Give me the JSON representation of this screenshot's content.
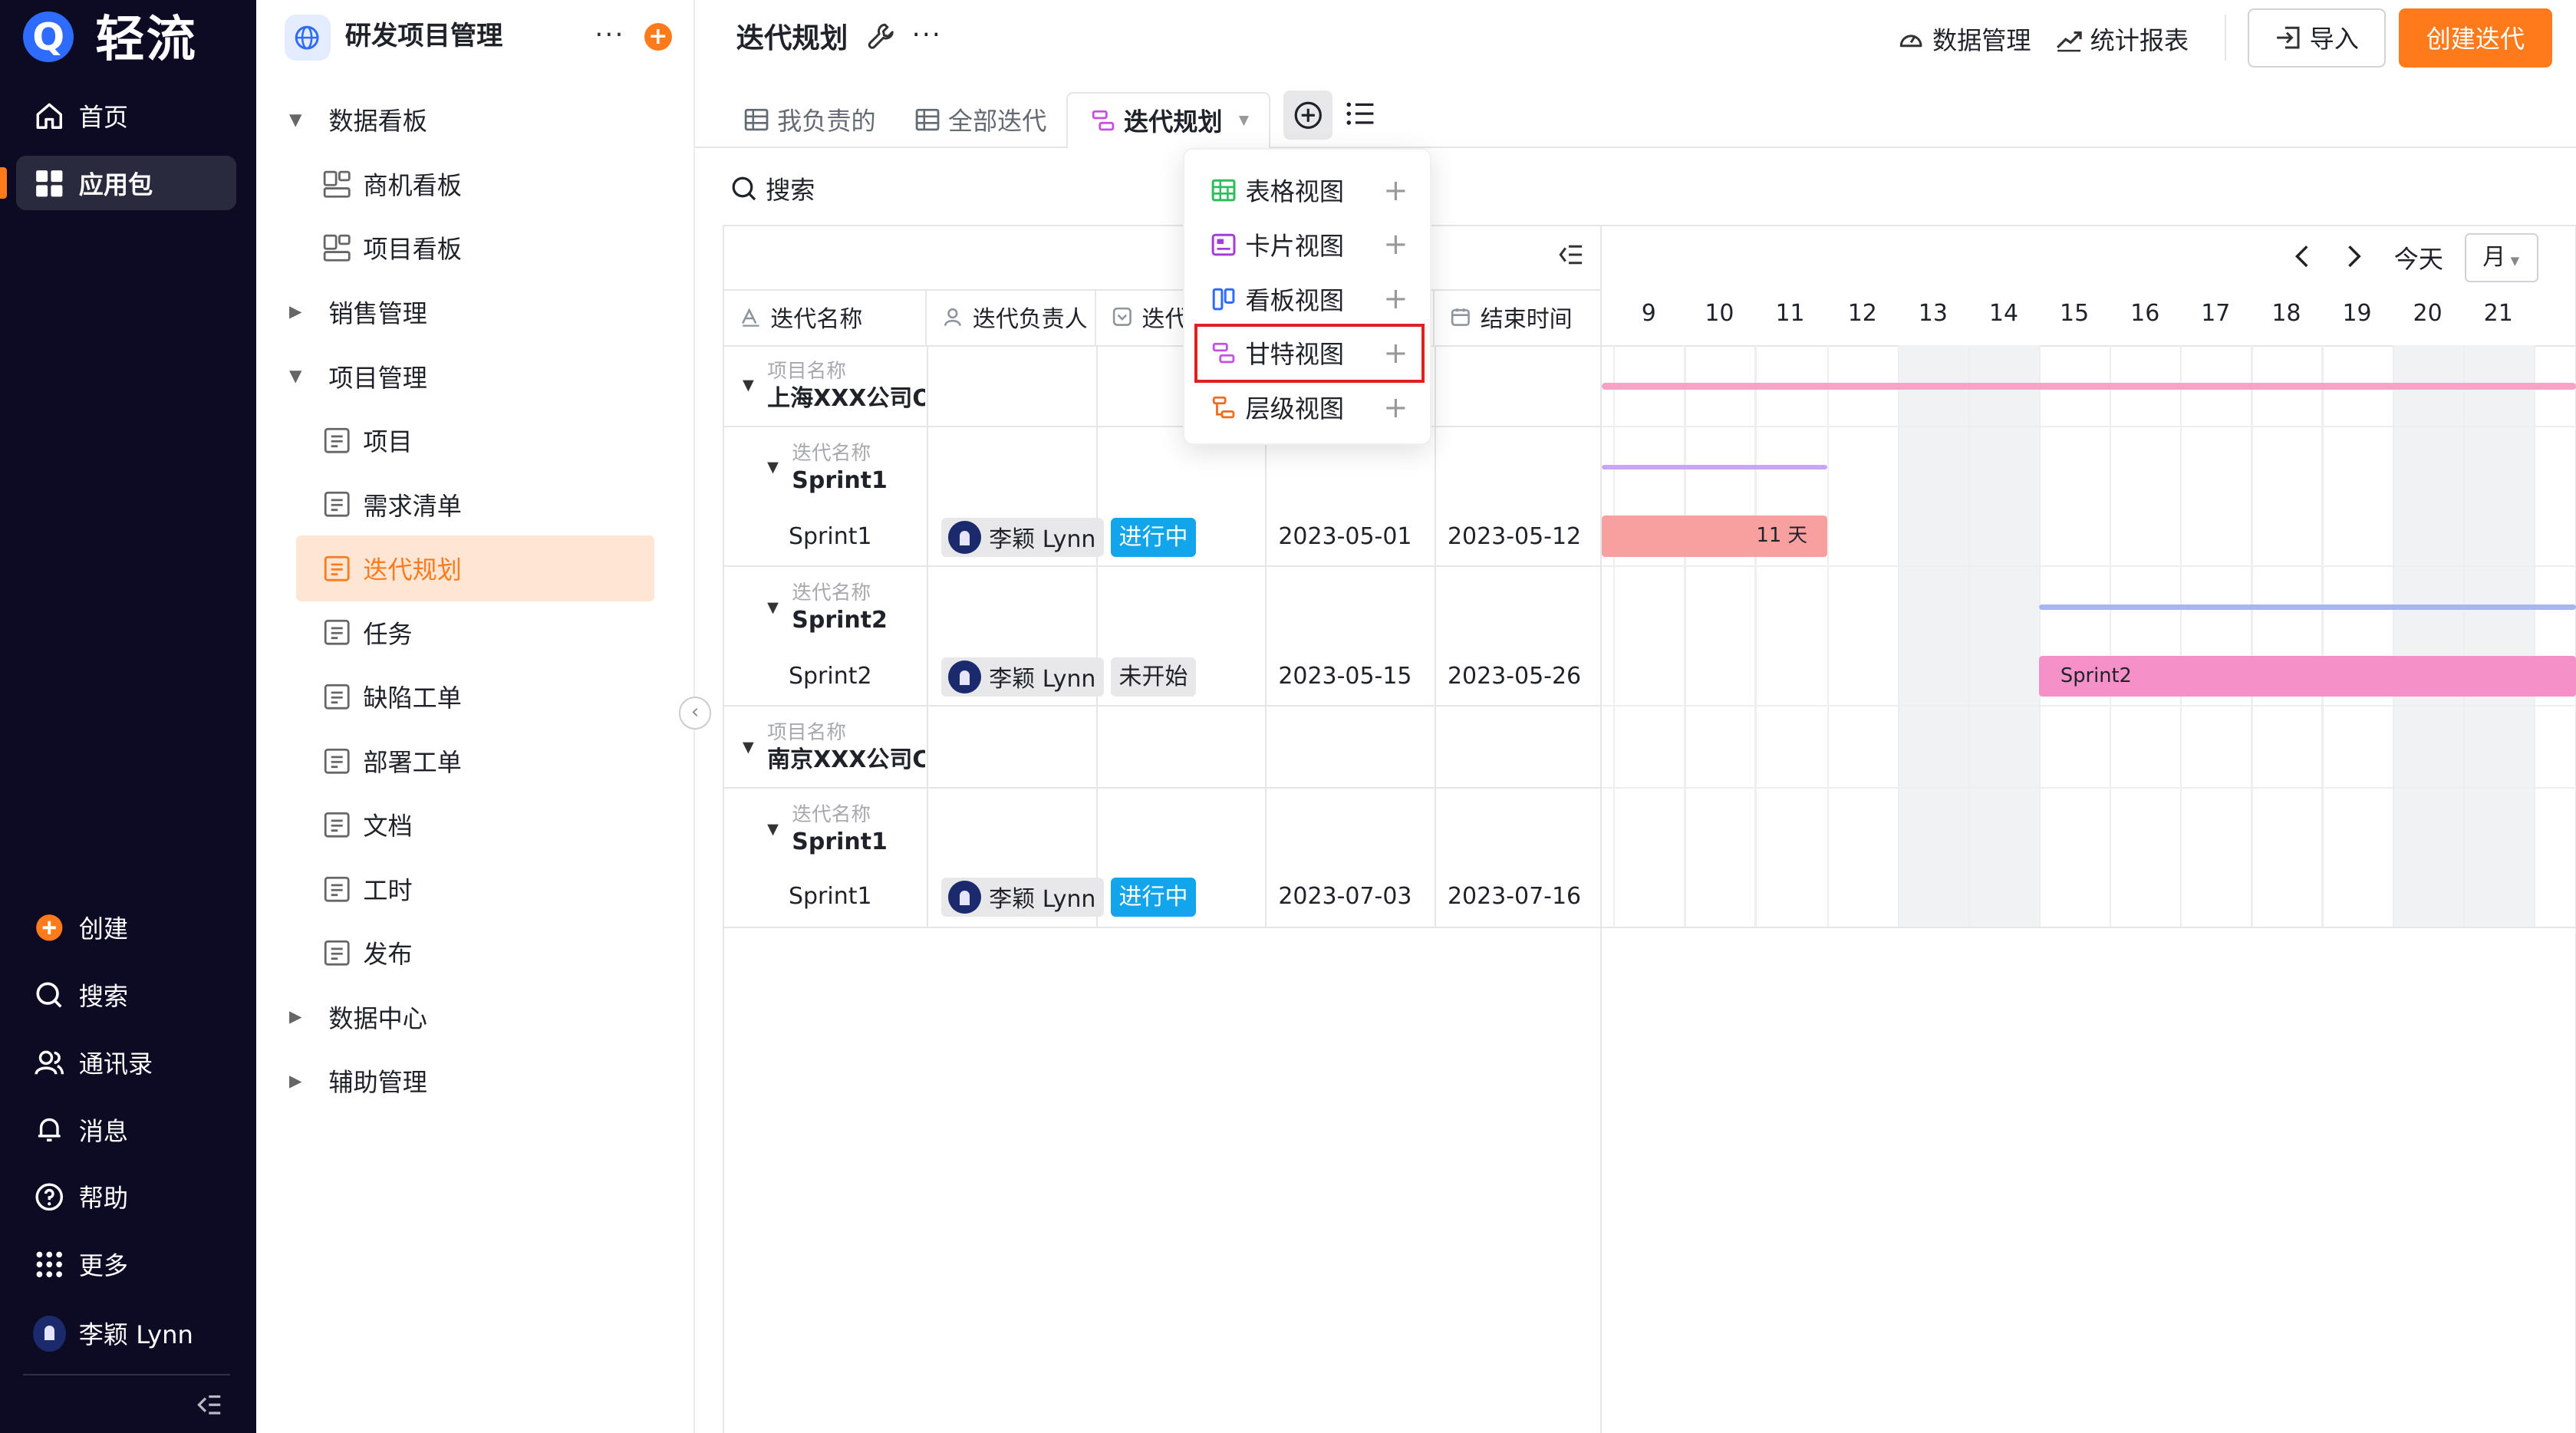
{
  "nav": {
    "logo_mark": "Q",
    "logo_text": "轻流",
    "top_items": [
      {
        "label": "首页",
        "icon": "home-icon"
      },
      {
        "label": "应用包",
        "icon": "grid-apps-icon",
        "active": true
      }
    ],
    "bottom_items": [
      {
        "label": "创建",
        "icon": "plus-circle-icon"
      },
      {
        "label": "搜索",
        "icon": "search-icon"
      },
      {
        "label": "通讯录",
        "icon": "contacts-icon"
      },
      {
        "label": "消息",
        "icon": "bell-icon"
      },
      {
        "label": "帮助",
        "icon": "help-icon"
      },
      {
        "label": "更多",
        "icon": "dots-grid-icon"
      }
    ],
    "user_name": "李颖 Lynn"
  },
  "sidebar": {
    "space_title": "研发项目管理",
    "more": "···",
    "add": "+",
    "tree": [
      {
        "label": "数据看板",
        "type": "group",
        "expanded": true
      },
      {
        "label": "商机看板",
        "type": "dashboard"
      },
      {
        "label": "项目看板",
        "type": "dashboard"
      },
      {
        "label": "销售管理",
        "type": "group",
        "expanded": false
      },
      {
        "label": "项目管理",
        "type": "group",
        "expanded": true
      },
      {
        "label": "项目",
        "type": "form"
      },
      {
        "label": "需求清单",
        "type": "form"
      },
      {
        "label": "迭代规划",
        "type": "form",
        "active": true
      },
      {
        "label": "任务",
        "type": "form"
      },
      {
        "label": "缺陷工单",
        "type": "form"
      },
      {
        "label": "部署工单",
        "type": "form"
      },
      {
        "label": "文档",
        "type": "form"
      },
      {
        "label": "工时",
        "type": "form"
      },
      {
        "label": "发布",
        "type": "form"
      },
      {
        "label": "数据中心",
        "type": "group",
        "expanded": false
      },
      {
        "label": "辅助管理",
        "type": "group",
        "expanded": false
      }
    ]
  },
  "header": {
    "title": "迭代规划",
    "more": "···",
    "data_manage": "数据管理",
    "stats_report": "统计报表",
    "import": "导入",
    "create": "创建迭代"
  },
  "tabs": {
    "mine": "我负责的",
    "all": "全部迭代",
    "active": "迭代规划"
  },
  "search_label": "搜索",
  "columns": [
    "迭代名称",
    "迭代负责人",
    "迭代",
    "结束时间"
  ],
  "group_label_project": "项目名称",
  "group_label_iteration": "迭代名称",
  "groups": [
    {
      "project": "上海XXX公司OA",
      "subgroups": [
        {
          "iteration": "Sprint1",
          "row": {
            "name": "Sprint1",
            "owner": "李颖 Lynn",
            "status": "进行中",
            "start": "2023-05-01",
            "end": "2023-05-12"
          }
        },
        {
          "iteration": "Sprint2",
          "row": {
            "name": "Sprint2",
            "owner": "李颖 Lynn",
            "status": "未开始",
            "start": "2023-05-15",
            "end": "2023-05-26"
          }
        }
      ]
    },
    {
      "project": "南京XXX公司CR",
      "subgroups": [
        {
          "iteration": "Sprint1",
          "row": {
            "name": "Sprint1",
            "owner": "李颖 Lynn",
            "status": "进行中",
            "start": "2023-07-03",
            "end": "2023-07-16"
          }
        }
      ]
    }
  ],
  "gantt": {
    "today": "今天",
    "scale": "月",
    "days": [
      "9",
      "10",
      "11",
      "12",
      "13",
      "14",
      "15",
      "16",
      "17",
      "18",
      "19",
      "20",
      "21"
    ],
    "bar1_label": "11 天",
    "bar2_label": "Sprint2",
    "colors": {
      "pink": "#f5a3c7",
      "purple": "#c9a6f5",
      "blue": "#a7b6f0",
      "salmon": "#f8a0a0",
      "sprint2": "#f590c8"
    }
  },
  "view_menu": [
    {
      "label": "表格视图",
      "icon": "table-view-icon"
    },
    {
      "label": "卡片视图",
      "icon": "card-view-icon"
    },
    {
      "label": "看板视图",
      "icon": "kanban-view-icon"
    },
    {
      "label": "甘特视图",
      "icon": "gantt-view-icon",
      "highlighted": true
    },
    {
      "label": "层级视图",
      "icon": "hierarchy-view-icon"
    }
  ]
}
